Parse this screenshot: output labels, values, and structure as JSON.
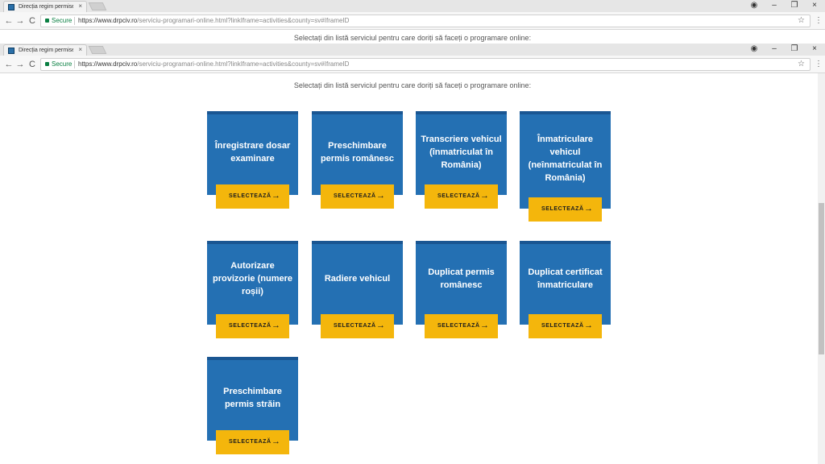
{
  "browser": {
    "tab_title": "Direcția regim permise de",
    "tab_close": "×",
    "url_secure": "Secure",
    "url_base": "https://www.drpciv.ro",
    "url_rest": "/serviciu-programari-online.html?linkIframe=activities&county=sv#IframeID",
    "nav_back": "←",
    "nav_forward": "→",
    "nav_reload": "C",
    "star": "☆",
    "menu": "⋮",
    "win_user": "◉",
    "win_min": "–",
    "win_restore": "❐",
    "win_close": "×"
  },
  "page": {
    "heading": "Selectați din listă serviciul pentru care doriți să faceți o programare online:",
    "button_label": "SELECTEAZĂ",
    "button_arrow": "→"
  },
  "services": [
    {
      "title": "Înregistrare dosar examinare"
    },
    {
      "title": "Preschimbare permis românesc"
    },
    {
      "title": "Transcriere vehicul (înmatriculat în România)"
    },
    {
      "title": "Înmatriculare vehicul (neînmatriculat în România)"
    },
    {
      "title": "Autorizare provizorie (numere roșii)"
    },
    {
      "title": "Radiere vehicul"
    },
    {
      "title": "Duplicat permis românesc"
    },
    {
      "title": "Duplicat certificat înmatriculare"
    },
    {
      "title": "Preschimbare permis străin"
    }
  ]
}
